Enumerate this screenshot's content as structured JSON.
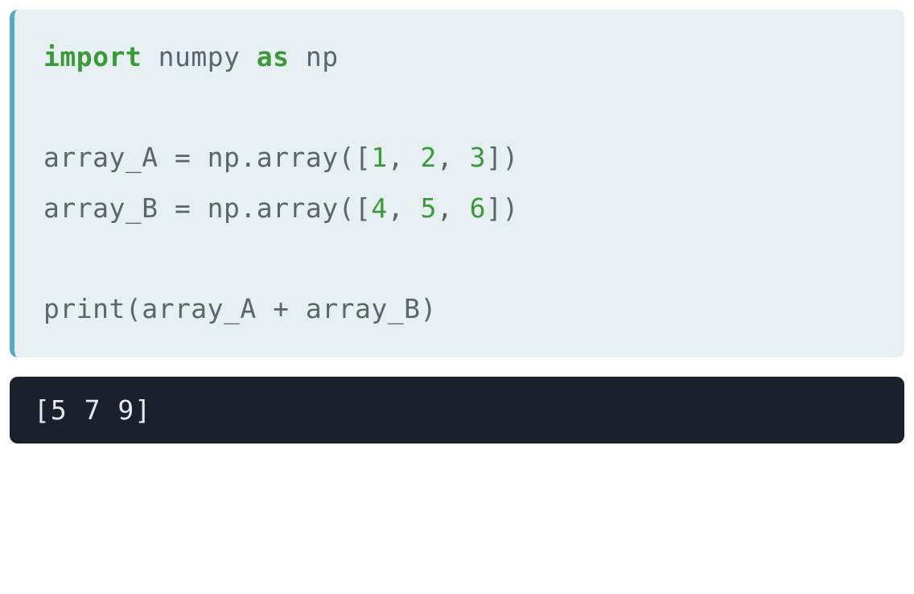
{
  "code": {
    "line1": {
      "kw1": "import",
      "mid": " numpy ",
      "kw2": "as",
      "end": " np"
    },
    "line2": {
      "pre": "array_A = np.array([",
      "n1": "1",
      "c1": ", ",
      "n2": "2",
      "c2": ", ",
      "n3": "3",
      "post": "])"
    },
    "line3": {
      "pre": "array_B = np.array([",
      "n1": "4",
      "c1": ", ",
      "n2": "5",
      "c2": ", ",
      "n3": "6",
      "post": "])"
    },
    "line4": "print(array_A + array_B)"
  },
  "output": "[5 7 9]"
}
